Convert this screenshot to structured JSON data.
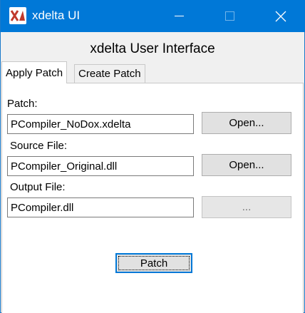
{
  "window": {
    "title": "xdelta UI",
    "icon": "xdelta-logo-icon",
    "controls": {
      "minimize": "minimize-icon",
      "maximize": "maximize-icon",
      "close": "close-icon"
    },
    "accent_color": "#0078d7"
  },
  "header": {
    "title": "xdelta User Interface"
  },
  "tabs": [
    {
      "label": "Apply Patch",
      "selected": true
    },
    {
      "label": "Create Patch",
      "selected": false
    }
  ],
  "form": {
    "patch": {
      "label": "Patch:",
      "value": "PCompiler_NoDox.xdelta",
      "button": "Open..."
    },
    "source": {
      "label": "Source File:",
      "value": "PCompiler_Original.dll",
      "button": "Open..."
    },
    "output": {
      "label": "Output File:",
      "value": "PCompiler.dll",
      "button": "..."
    },
    "submit": "Patch"
  }
}
